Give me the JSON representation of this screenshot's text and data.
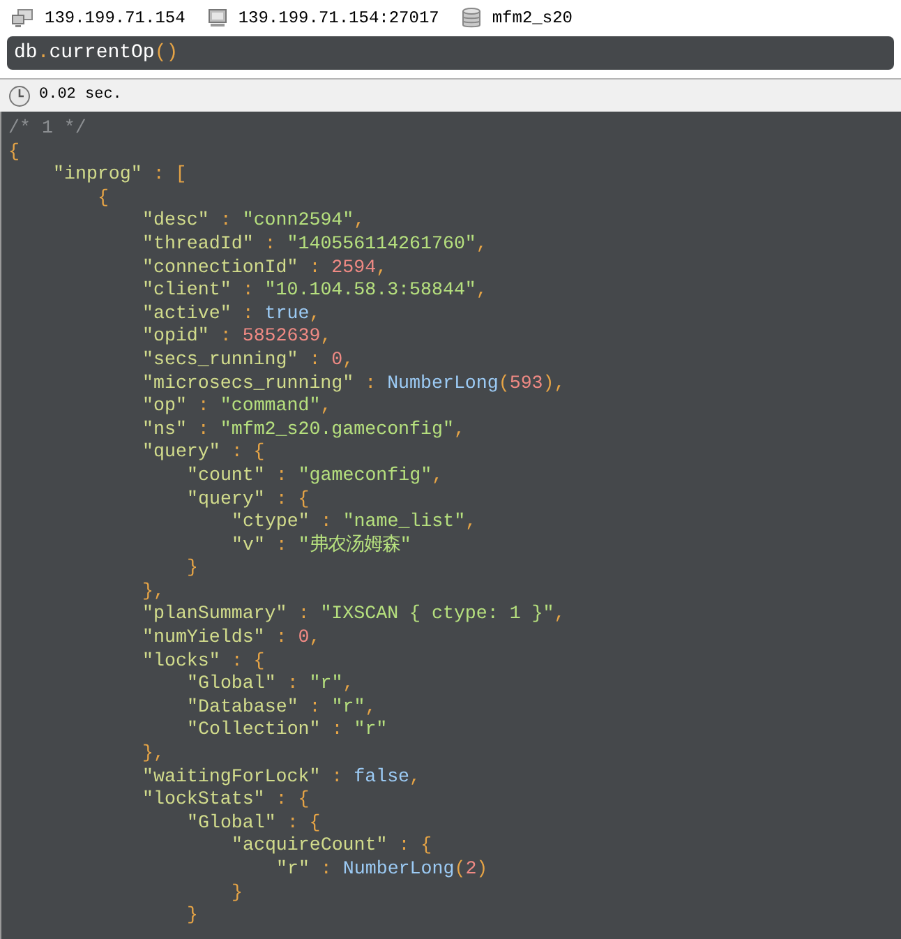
{
  "connection": {
    "host": "139.199.71.154",
    "server": "139.199.71.154:27017",
    "database": "mfm2_s20"
  },
  "query": {
    "tokens": [
      {
        "kind": "ident",
        "text": "db"
      },
      {
        "kind": "punct",
        "text": "."
      },
      {
        "kind": "ident",
        "text": "currentOp"
      },
      {
        "kind": "punct",
        "text": "()"
      }
    ]
  },
  "status_bar": {
    "elapsed": "0.02 sec."
  },
  "result_lines": [
    {
      "tokens": [
        {
          "kind": "comment",
          "text": "/* 1 */"
        }
      ]
    },
    {
      "tokens": [
        {
          "kind": "punct",
          "text": "{"
        }
      ],
      "children": [
        {
          "tokens": [
            {
              "kind": "key",
              "text": "\"inprog\""
            },
            {
              "kind": "punct",
              "text": " : ["
            }
          ],
          "children": [
            {
              "tokens": [
                {
                  "kind": "punct",
                  "text": "{"
                }
              ],
              "children": [
                {
                  "tokens": [
                    {
                      "kind": "key",
                      "text": "\"desc\""
                    },
                    {
                      "kind": "punct",
                      "text": " : "
                    },
                    {
                      "kind": "string",
                      "text": "\"conn2594\""
                    },
                    {
                      "kind": "punct",
                      "text": ","
                    }
                  ]
                },
                {
                  "tokens": [
                    {
                      "kind": "key",
                      "text": "\"threadId\""
                    },
                    {
                      "kind": "punct",
                      "text": " : "
                    },
                    {
                      "kind": "string",
                      "text": "\"140556114261760\""
                    },
                    {
                      "kind": "punct",
                      "text": ","
                    }
                  ]
                },
                {
                  "tokens": [
                    {
                      "kind": "key",
                      "text": "\"connectionId\""
                    },
                    {
                      "kind": "punct",
                      "text": " : "
                    },
                    {
                      "kind": "number",
                      "text": "2594"
                    },
                    {
                      "kind": "punct",
                      "text": ","
                    }
                  ]
                },
                {
                  "tokens": [
                    {
                      "kind": "key",
                      "text": "\"client\""
                    },
                    {
                      "kind": "punct",
                      "text": " : "
                    },
                    {
                      "kind": "string",
                      "text": "\"10.104.58.3:58844\""
                    },
                    {
                      "kind": "punct",
                      "text": ","
                    }
                  ]
                },
                {
                  "tokens": [
                    {
                      "kind": "key",
                      "text": "\"active\""
                    },
                    {
                      "kind": "punct",
                      "text": " : "
                    },
                    {
                      "kind": "literal",
                      "text": "true"
                    },
                    {
                      "kind": "punct",
                      "text": ","
                    }
                  ]
                },
                {
                  "tokens": [
                    {
                      "kind": "key",
                      "text": "\"opid\""
                    },
                    {
                      "kind": "punct",
                      "text": " : "
                    },
                    {
                      "kind": "number",
                      "text": "5852639"
                    },
                    {
                      "kind": "punct",
                      "text": ","
                    }
                  ]
                },
                {
                  "tokens": [
                    {
                      "kind": "key",
                      "text": "\"secs_running\""
                    },
                    {
                      "kind": "punct",
                      "text": " : "
                    },
                    {
                      "kind": "number",
                      "text": "0"
                    },
                    {
                      "kind": "punct",
                      "text": ","
                    }
                  ]
                },
                {
                  "tokens": [
                    {
                      "kind": "key",
                      "text": "\"microsecs_running\""
                    },
                    {
                      "kind": "punct",
                      "text": " : "
                    },
                    {
                      "kind": "literal",
                      "text": "NumberLong"
                    },
                    {
                      "kind": "punct",
                      "text": "("
                    },
                    {
                      "kind": "number",
                      "text": "593"
                    },
                    {
                      "kind": "punct",
                      "text": "),"
                    }
                  ]
                },
                {
                  "tokens": [
                    {
                      "kind": "key",
                      "text": "\"op\""
                    },
                    {
                      "kind": "punct",
                      "text": " : "
                    },
                    {
                      "kind": "string",
                      "text": "\"command\""
                    },
                    {
                      "kind": "punct",
                      "text": ","
                    }
                  ]
                },
                {
                  "tokens": [
                    {
                      "kind": "key",
                      "text": "\"ns\""
                    },
                    {
                      "kind": "punct",
                      "text": " : "
                    },
                    {
                      "kind": "string",
                      "text": "\"mfm2_s20.gameconfig\""
                    },
                    {
                      "kind": "punct",
                      "text": ","
                    }
                  ]
                },
                {
                  "tokens": [
                    {
                      "kind": "key",
                      "text": "\"query\""
                    },
                    {
                      "kind": "punct",
                      "text": " : {"
                    }
                  ],
                  "children": [
                    {
                      "tokens": [
                        {
                          "kind": "key",
                          "text": "\"count\""
                        },
                        {
                          "kind": "punct",
                          "text": " : "
                        },
                        {
                          "kind": "string",
                          "text": "\"gameconfig\""
                        },
                        {
                          "kind": "punct",
                          "text": ","
                        }
                      ]
                    },
                    {
                      "tokens": [
                        {
                          "kind": "key",
                          "text": "\"query\""
                        },
                        {
                          "kind": "punct",
                          "text": " : {"
                        }
                      ],
                      "children": [
                        {
                          "tokens": [
                            {
                              "kind": "key",
                              "text": "\"ctype\""
                            },
                            {
                              "kind": "punct",
                              "text": " : "
                            },
                            {
                              "kind": "string",
                              "text": "\"name_list\""
                            },
                            {
                              "kind": "punct",
                              "text": ","
                            }
                          ]
                        },
                        {
                          "tokens": [
                            {
                              "kind": "key",
                              "text": "\"v\""
                            },
                            {
                              "kind": "punct",
                              "text": " : "
                            },
                            {
                              "kind": "string",
                              "text": "\"弗农汤姆森\""
                            }
                          ]
                        }
                      ]
                    },
                    {
                      "tokens": [
                        {
                          "kind": "punct",
                          "text": "}"
                        }
                      ]
                    }
                  ]
                },
                {
                  "tokens": [
                    {
                      "kind": "punct",
                      "text": "},"
                    }
                  ]
                },
                {
                  "tokens": [
                    {
                      "kind": "key",
                      "text": "\"planSummary\""
                    },
                    {
                      "kind": "punct",
                      "text": " : "
                    },
                    {
                      "kind": "string",
                      "text": "\"IXSCAN { ctype: 1 }\""
                    },
                    {
                      "kind": "punct",
                      "text": ","
                    }
                  ]
                },
                {
                  "tokens": [
                    {
                      "kind": "key",
                      "text": "\"numYields\""
                    },
                    {
                      "kind": "punct",
                      "text": " : "
                    },
                    {
                      "kind": "number",
                      "text": "0"
                    },
                    {
                      "kind": "punct",
                      "text": ","
                    }
                  ]
                },
                {
                  "tokens": [
                    {
                      "kind": "key",
                      "text": "\"locks\""
                    },
                    {
                      "kind": "punct",
                      "text": " : {"
                    }
                  ],
                  "children": [
                    {
                      "tokens": [
                        {
                          "kind": "key",
                          "text": "\"Global\""
                        },
                        {
                          "kind": "punct",
                          "text": " : "
                        },
                        {
                          "kind": "string",
                          "text": "\"r\""
                        },
                        {
                          "kind": "punct",
                          "text": ","
                        }
                      ]
                    },
                    {
                      "tokens": [
                        {
                          "kind": "key",
                          "text": "\"Database\""
                        },
                        {
                          "kind": "punct",
                          "text": " : "
                        },
                        {
                          "kind": "string",
                          "text": "\"r\""
                        },
                        {
                          "kind": "punct",
                          "text": ","
                        }
                      ]
                    },
                    {
                      "tokens": [
                        {
                          "kind": "key",
                          "text": "\"Collection\""
                        },
                        {
                          "kind": "punct",
                          "text": " : "
                        },
                        {
                          "kind": "string",
                          "text": "\"r\""
                        }
                      ]
                    }
                  ]
                },
                {
                  "tokens": [
                    {
                      "kind": "punct",
                      "text": "},"
                    }
                  ]
                },
                {
                  "tokens": [
                    {
                      "kind": "key",
                      "text": "\"waitingForLock\""
                    },
                    {
                      "kind": "punct",
                      "text": " : "
                    },
                    {
                      "kind": "literal",
                      "text": "false"
                    },
                    {
                      "kind": "punct",
                      "text": ","
                    }
                  ]
                },
                {
                  "tokens": [
                    {
                      "kind": "key",
                      "text": "\"lockStats\""
                    },
                    {
                      "kind": "punct",
                      "text": " : {"
                    }
                  ],
                  "children": [
                    {
                      "tokens": [
                        {
                          "kind": "key",
                          "text": "\"Global\""
                        },
                        {
                          "kind": "punct",
                          "text": " : {"
                        }
                      ],
                      "children": [
                        {
                          "tokens": [
                            {
                              "kind": "key",
                              "text": "\"acquireCount\""
                            },
                            {
                              "kind": "punct",
                              "text": " : {"
                            }
                          ],
                          "children": [
                            {
                              "tokens": [
                                {
                                  "kind": "key",
                                  "text": "\"r\""
                                },
                                {
                                  "kind": "punct",
                                  "text": " : "
                                },
                                {
                                  "kind": "literal",
                                  "text": "NumberLong"
                                },
                                {
                                  "kind": "punct",
                                  "text": "("
                                },
                                {
                                  "kind": "number",
                                  "text": "2"
                                },
                                {
                                  "kind": "punct",
                                  "text": ")"
                                }
                              ]
                            }
                          ]
                        },
                        {
                          "tokens": [
                            {
                              "kind": "punct",
                              "text": "}"
                            }
                          ]
                        }
                      ]
                    },
                    {
                      "tokens": [
                        {
                          "kind": "punct",
                          "text": "}"
                        }
                      ]
                    }
                  ]
                }
              ]
            }
          ]
        }
      ]
    }
  ]
}
